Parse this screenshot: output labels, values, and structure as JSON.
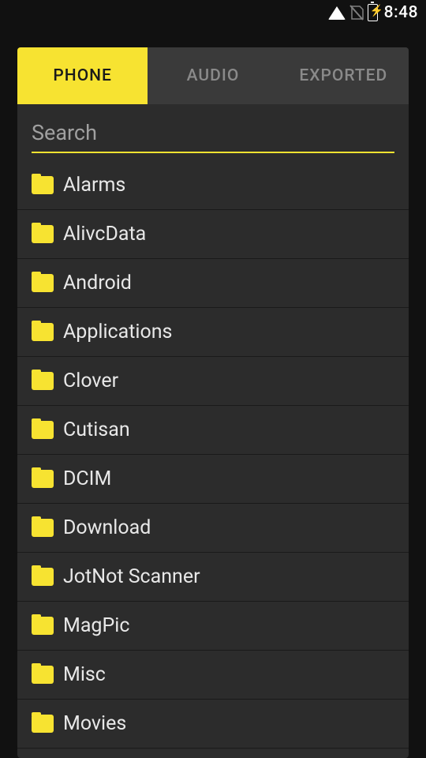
{
  "status": {
    "time": "8:48"
  },
  "tabs": {
    "items": [
      {
        "label": "PHONE",
        "active": true
      },
      {
        "label": "AUDIO",
        "active": false
      },
      {
        "label": "EXPORTED",
        "active": false
      }
    ]
  },
  "search": {
    "placeholder": "Search"
  },
  "folders": {
    "items": [
      {
        "name": "Alarms"
      },
      {
        "name": "AlivcData"
      },
      {
        "name": "Android"
      },
      {
        "name": "Applications"
      },
      {
        "name": "Clover"
      },
      {
        "name": "Cutisan"
      },
      {
        "name": "DCIM"
      },
      {
        "name": "Download"
      },
      {
        "name": "JotNot Scanner"
      },
      {
        "name": "MagPic"
      },
      {
        "name": "Misc"
      },
      {
        "name": "Movies"
      }
    ]
  }
}
